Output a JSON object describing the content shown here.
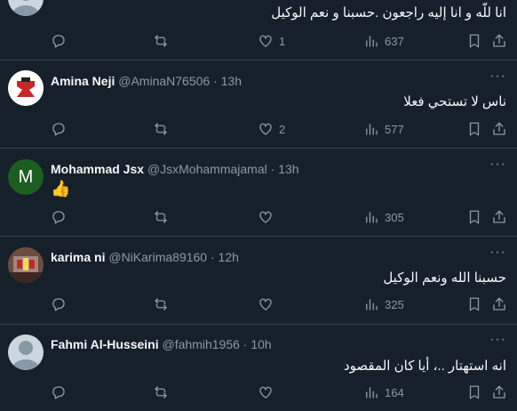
{
  "tweets": [
    {
      "name": "",
      "handle": "",
      "time": "",
      "text": "انا للّه و انا إليه راجعون .حسبنا و نعم الوكيل",
      "reply_count": "",
      "retweet_count": "",
      "like_count": "1",
      "view_count": "637"
    },
    {
      "name": "Amina Neji",
      "handle": "@AminaN76506",
      "time": "13h",
      "text": "ناس لا تستحي فعلا",
      "like_count": "2",
      "view_count": "577"
    },
    {
      "name": "Mohammad Jsx",
      "handle": "@JsxMohammajamal",
      "time": "13h",
      "text": "👍",
      "like_count": "",
      "view_count": "305",
      "avatar_letter": "M"
    },
    {
      "name": "karima ni",
      "handle": "@NiKarima89160",
      "time": "12h",
      "text": "حسبنا الله ونعم الوكيل",
      "like_count": "",
      "view_count": "325"
    },
    {
      "name": "Fahmi Al-Husseini",
      "handle": "@fahmih1956",
      "time": "10h",
      "text": "انه استهتار ..، أيا كان المقصود",
      "like_count": "",
      "view_count": "164"
    }
  ],
  "separator": "·",
  "more_glyph": "···",
  "colors": {
    "background": "#15202b",
    "text": "#f7f9f9",
    "secondary": "#8b98a5",
    "border": "#38444d",
    "avatar_green": "#1b5e20"
  },
  "icons": [
    "reply-icon",
    "retweet-icon",
    "like-icon",
    "views-icon",
    "bookmark-icon",
    "share-icon"
  ]
}
